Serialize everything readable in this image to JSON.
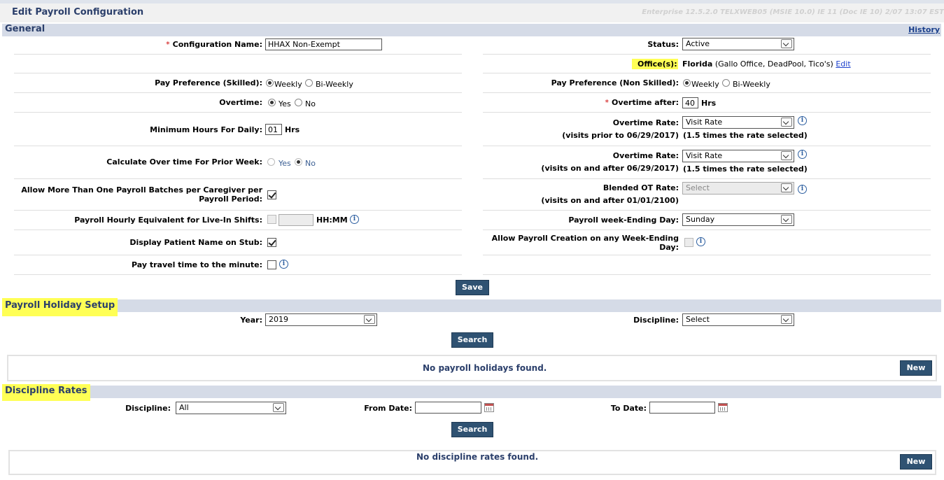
{
  "page": {
    "title": "Edit Payroll Configuration",
    "version": "Enterprise 12.5.2.0 TELXWEB05 (MSIE 10.0) IE 11 (Doc IE 10) 2/07 13:07 EST"
  },
  "general": {
    "title": "General",
    "history_link": "History",
    "config_name": {
      "label": "Configuration Name:",
      "value": "HHAX Non-Exempt"
    },
    "status": {
      "label": "Status:",
      "value": "Active"
    },
    "offices": {
      "label": "Office(s):",
      "primary": "Florida",
      "others": "(Gallo Office, DeadPool, Tico's)",
      "edit": "Edit"
    },
    "pay_pref_skilled": {
      "label": "Pay Preference (Skilled):",
      "opt1": "Weekly",
      "opt2": "Bi-Weekly"
    },
    "pay_pref_nonskilled": {
      "label": "Pay Preference (Non Skilled):",
      "opt1": "Weekly",
      "opt2": "Bi-Weekly"
    },
    "overtime": {
      "label": "Overtime:",
      "opt1": "Yes",
      "opt2": "No"
    },
    "overtime_after": {
      "label": "Overtime after:",
      "value": "40",
      "unit": "Hrs"
    },
    "min_hours": {
      "label": "Minimum Hours For Daily:",
      "value": "01",
      "unit": "Hrs"
    },
    "ot_rate_prior": {
      "label": "Overtime Rate:",
      "sublabel": "(visits prior to 06/29/2017)",
      "value": "Visit Rate",
      "note": "(1.5 times the rate selected)"
    },
    "calc_ot_prior": {
      "label": "Calculate Over time For Prior Week:",
      "opt1": "Yes",
      "opt2": "No"
    },
    "ot_rate_after": {
      "label": "Overtime Rate:",
      "sublabel": "(visits on and after 06/29/2017)",
      "value": "Visit Rate",
      "note": "(1.5 times the rate selected)"
    },
    "allow_multi": {
      "label1": "Allow More Than One Payroll Batches per Caregiver per",
      "label2": "Payroll Period:"
    },
    "blended_ot": {
      "label": "Blended OT Rate:",
      "sublabel": "(visits on and after 01/01/2100)",
      "value": "Select"
    },
    "hourly_equiv": {
      "label": "Payroll Hourly Equivalent for Live-In Shifts:",
      "unit": "HH:MM"
    },
    "week_ending": {
      "label": "Payroll week-Ending Day:",
      "value": "Sunday"
    },
    "display_patient": {
      "label": "Display Patient Name on Stub:"
    },
    "allow_any_week": {
      "label1": "Allow Payroll Creation on any Week-Ending",
      "label2": "Day:"
    },
    "pay_travel": {
      "label": "Pay travel time to the minute:"
    },
    "save": "Save"
  },
  "holiday": {
    "title": "Payroll Holiday Setup",
    "year": {
      "label": "Year:",
      "value": "2019"
    },
    "discipline": {
      "label": "Discipline:",
      "value": "Select"
    },
    "search": "Search",
    "empty": "No payroll holidays found.",
    "new": "New"
  },
  "rates": {
    "title": "Discipline Rates",
    "discipline": {
      "label": "Discipline:",
      "value": "All"
    },
    "from": {
      "label": "From Date:",
      "value": ""
    },
    "to": {
      "label": "To Date:",
      "value": ""
    },
    "search": "Search",
    "empty": "No discipline rates found.",
    "new": "New"
  },
  "icons": {
    "info": "i"
  },
  "colors": {
    "header_text": "#2b3f6b",
    "section_bg": "#d5dbe7",
    "highlight": "#ffff55",
    "button": "#2f5272"
  }
}
